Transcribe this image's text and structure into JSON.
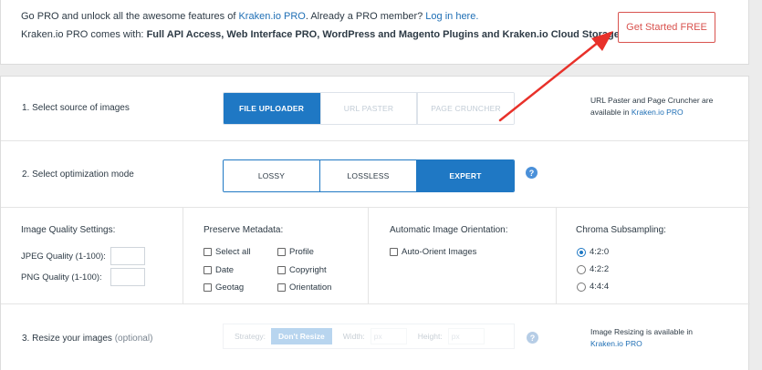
{
  "promo": {
    "line1_prefix": "Go PRO and unlock all the awesome features of ",
    "line1_link1": "Kraken.io PRO",
    "line1_middle": ". Already a PRO member? ",
    "line1_link2": "Log in here.",
    "line2_prefix": "Kraken.io PRO comes with: ",
    "line2_bold": "Full API Access, Web Interface PRO, WordPress and Magento Plugins and Kraken.io Cloud Storage.",
    "cta_label": "Get Started FREE"
  },
  "source": {
    "label": "1. Select source of images",
    "options": [
      "FILE UPLOADER",
      "URL PASTER",
      "PAGE CRUNCHER"
    ],
    "active_index": 0,
    "note_text": "URL Paster and Page Cruncher are available in ",
    "note_link": "Kraken.io PRO"
  },
  "mode": {
    "label": "2. Select optimization mode",
    "options": [
      "LOSSY",
      "LOSSLESS",
      "EXPERT"
    ],
    "active_index": 2,
    "help_glyph": "?"
  },
  "settings": {
    "quality_title": "Image Quality Settings:",
    "jpeg_label": "JPEG Quality (1-100):",
    "png_label": "PNG Quality (1-100):",
    "metadata_title": "Preserve Metadata:",
    "metadata_options": [
      "Select all",
      "Profile",
      "Date",
      "Copyright",
      "Geotag",
      "Orientation"
    ],
    "orientation_title": "Automatic Image Orientation:",
    "orientation_option": "Auto-Orient Images",
    "chroma_title": "Chroma Subsampling:",
    "chroma_options": [
      "4:2:0",
      "4:2:2",
      "4:4:4"
    ],
    "chroma_selected": "4:2:0"
  },
  "resize": {
    "label_prefix": "3. Resize your images ",
    "label_optional": "(optional)",
    "strategy_label": "Strategy:",
    "strategy_value": "Don't Resize",
    "width_label": "Width:",
    "width_placeholder": "px",
    "height_label": "Height:",
    "height_placeholder": "px",
    "note_text": "Image Resizing is available in ",
    "note_link": "Kraken.io PRO",
    "help_glyph": "?"
  },
  "colors": {
    "accent": "#1f78c4",
    "cta_red": "#d9534f",
    "link": "#1f6fb5",
    "annotation_arrow": "#e8312a"
  }
}
